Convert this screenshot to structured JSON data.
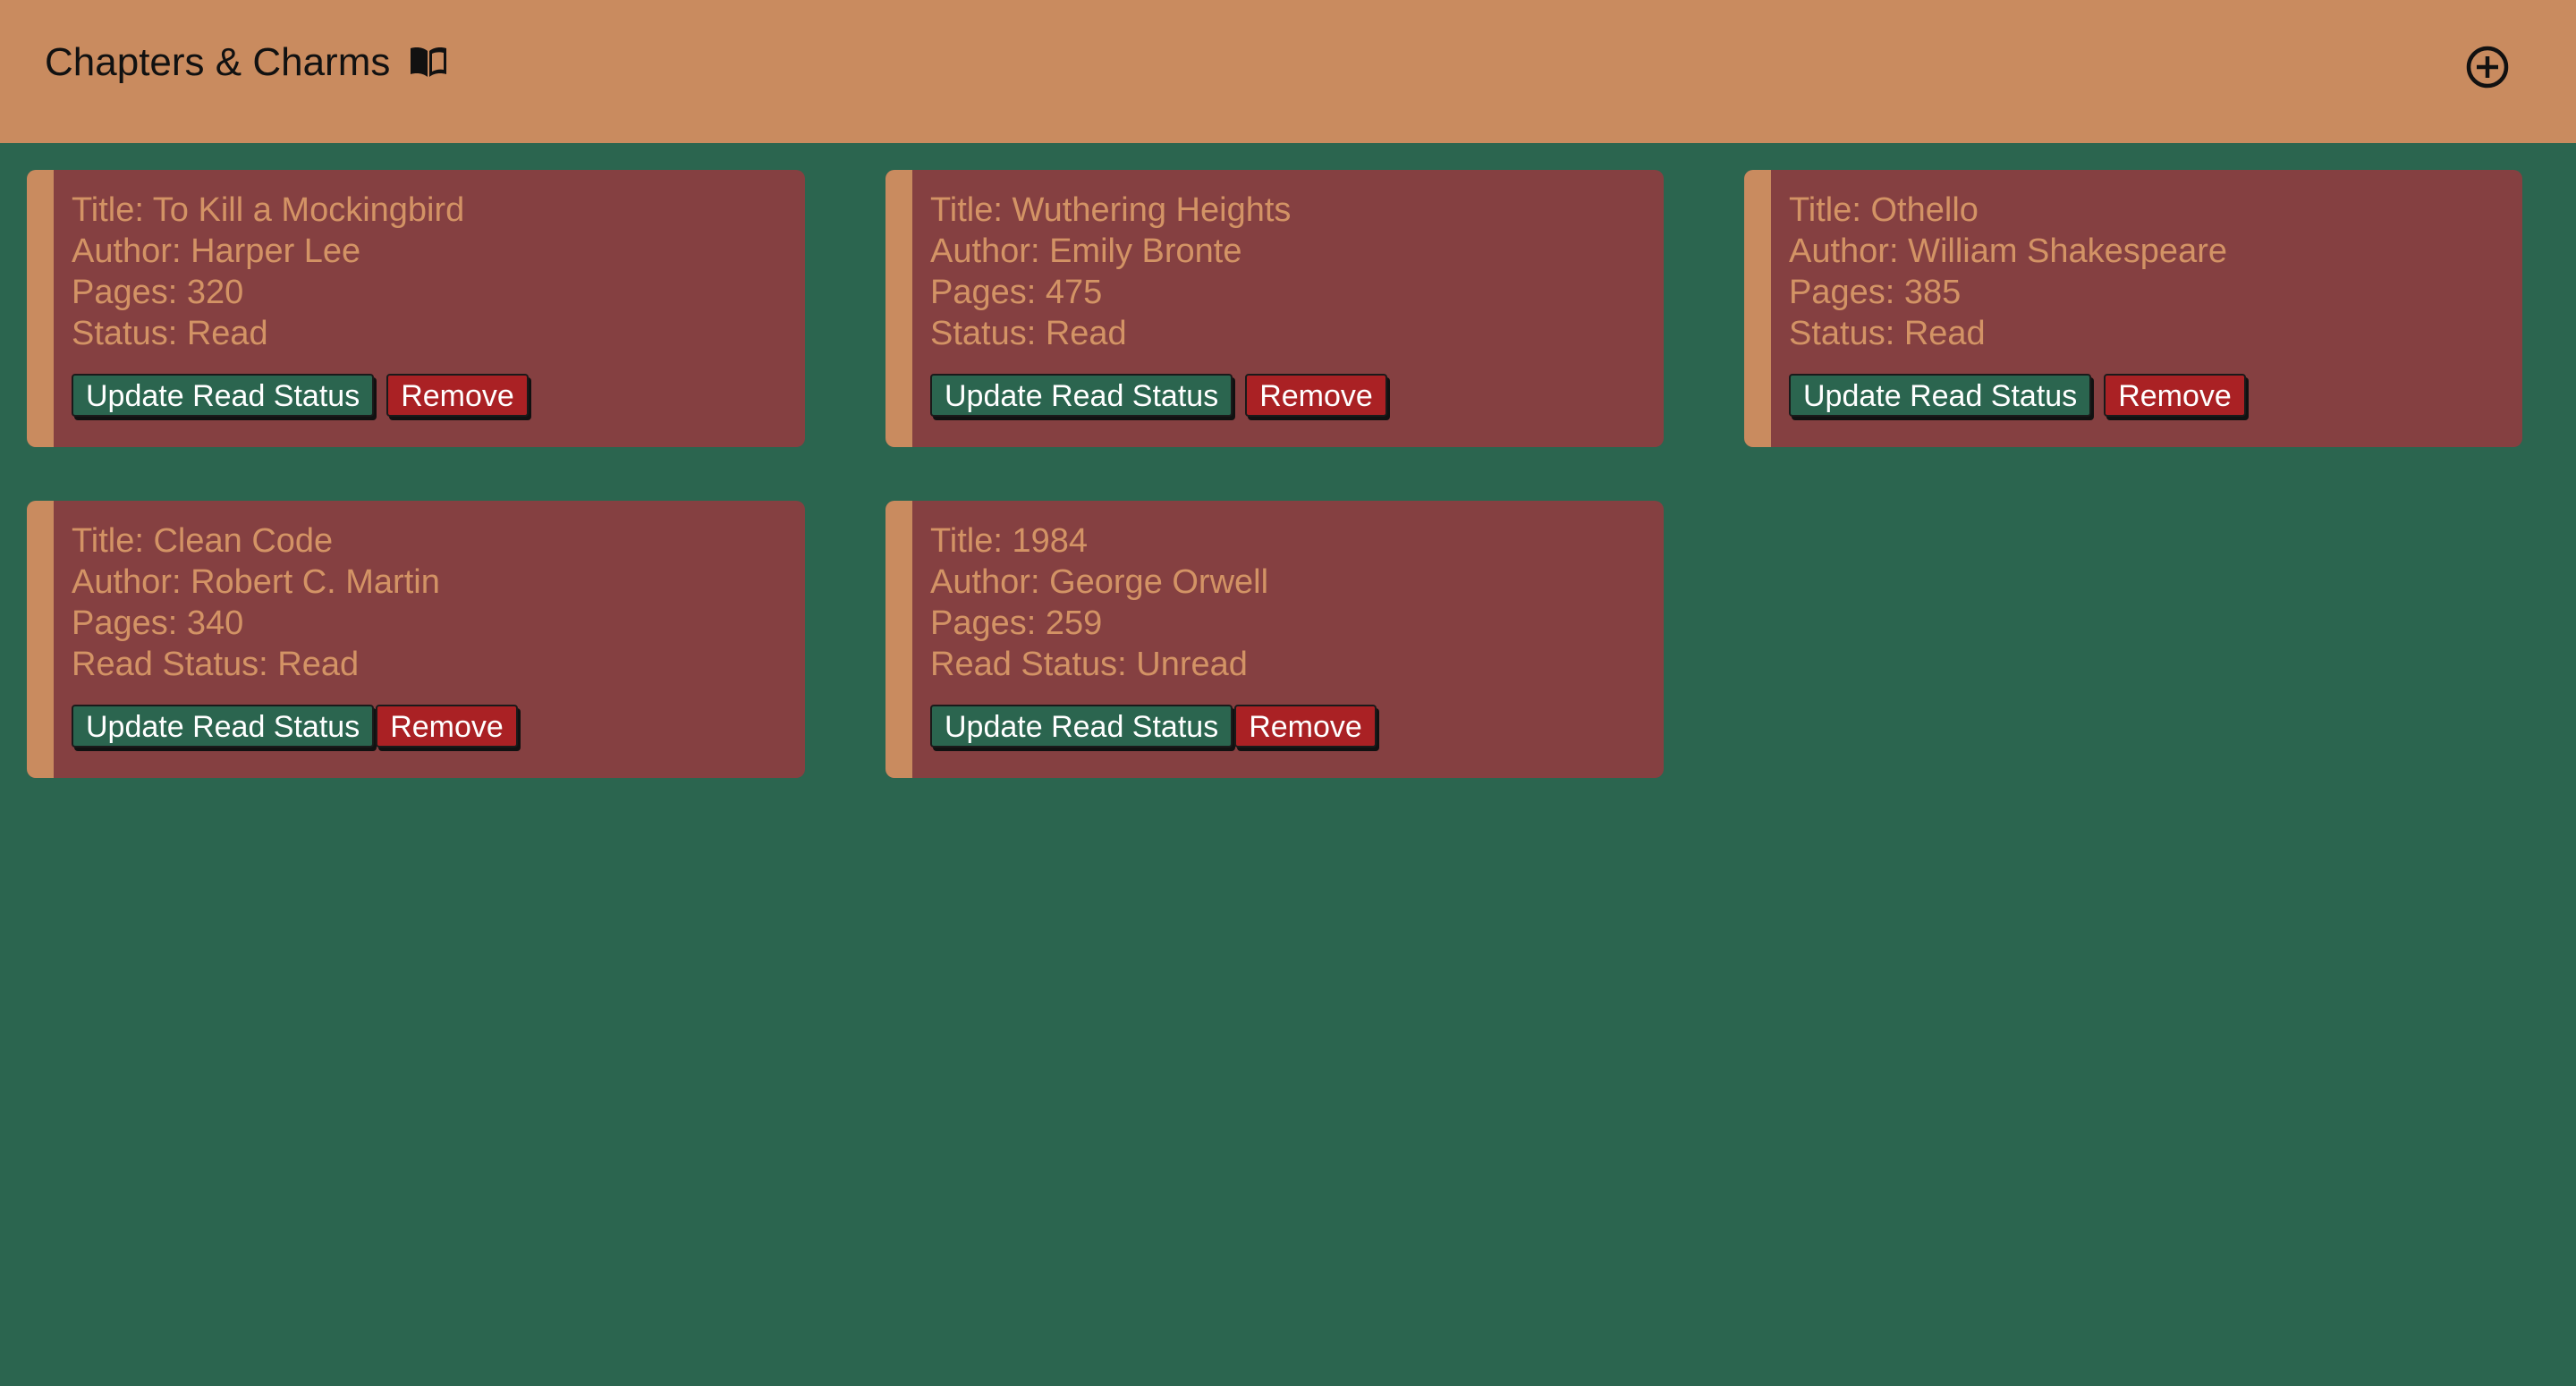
{
  "header": {
    "title": "Chapters & Charms",
    "title_icon": "book-icon",
    "add_icon": "plus-circle-icon"
  },
  "colors": {
    "background": "#2b654f",
    "header": "#c98b5f",
    "card": "#854041",
    "card_text": "#d39365",
    "update_button": "#2b654f",
    "remove_button": "#aa2124"
  },
  "books": [
    {
      "title_line": "Title: To Kill a Mockingbird",
      "author_line": "Author: Harper Lee",
      "pages_line": "Pages: 320",
      "status_line": "Status: Read",
      "update_label": "Update Read Status",
      "remove_label": "Remove"
    },
    {
      "title_line": "Title: Wuthering Heights",
      "author_line": "Author: Emily Bronte",
      "pages_line": "Pages: 475",
      "status_line": "Status: Read",
      "update_label": "Update Read Status",
      "remove_label": "Remove"
    },
    {
      "title_line": "Title: Othello",
      "author_line": "Author: William Shakespeare",
      "pages_line": "Pages: 385",
      "status_line": "Status: Read",
      "update_label": "Update Read Status",
      "remove_label": "Remove"
    },
    {
      "title_line": "Title: Clean Code",
      "author_line": "Author: Robert C. Martin",
      "pages_line": "Pages: 340",
      "status_line": "Read Status: Read",
      "update_label": "Update Read Status",
      "remove_label": "Remove"
    },
    {
      "title_line": "Title: 1984",
      "author_line": "Author: George Orwell",
      "pages_line": "Pages: 259",
      "status_line": "Read Status: Unread",
      "update_label": "Update Read Status",
      "remove_label": "Remove"
    }
  ]
}
